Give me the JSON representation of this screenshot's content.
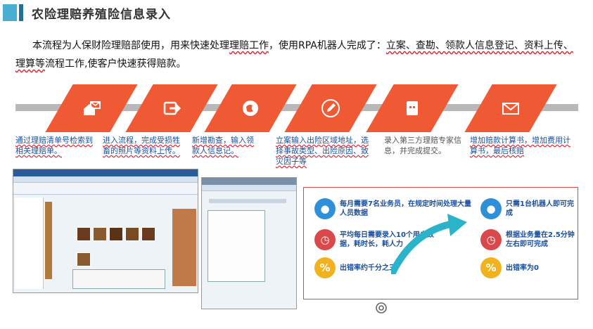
{
  "title": "农险理赔养殖险信息录入",
  "intro_plain_1": "本流程为人保财险理赔部使用，用来快速处理",
  "intro_u_1": "理赔工作",
  "intro_plain_2": "，使用RPA机器人完成了：",
  "intro_u_2": "立案、查勘、领款人信息登记、资料上传、理算等",
  "intro_plain_3": "流程工作,使客户快速获得赔款。",
  "colors": {
    "accent": "#ef5a34",
    "title_block": "#4aaed3",
    "track": "#b8b8b8",
    "link_text": "#1b4f9c",
    "panel_border": "#e04848"
  },
  "steps": [
    {
      "icon": "home-mail-icon",
      "caption": "通过理赔清单号检索到相关理赔单。"
    },
    {
      "icon": "enter-arrow-icon",
      "caption": "进入流程，完成受损牲畜的照片等资料上传。"
    },
    {
      "icon": "new-survey-icon",
      "caption": "新增勘查，输入领款人信息记。"
    },
    {
      "icon": "edit-icon",
      "caption": "立案输入出险区域地址，选择事故类型、出险原因、致灾因子等"
    },
    {
      "icon": "expert-info-icon",
      "caption": "录入第三方理赔专家信息，并完成提交。"
    },
    {
      "icon": "mail-icon",
      "caption": "增加赔款计算书，增加费用计算书，最后核赔"
    }
  ],
  "compare": {
    "before": [
      {
        "icon": "person-icon",
        "color": "#2f8fd8",
        "text": "每月需要7名业务员，在规定时间处理大量人员数据"
      },
      {
        "icon": "clock-icon",
        "color": "#d9484a",
        "text": "平均每日需要录入10个用户数据，耗时长，耗人力"
      },
      {
        "icon": "percent-icon",
        "color": "#f0b21e",
        "text": "出错率约千分之三"
      }
    ],
    "after": [
      {
        "icon": "person-icon",
        "color": "#2f8fd8",
        "text": "只需1台机器人即可完成"
      },
      {
        "icon": "clock-icon",
        "color": "#d9484a",
        "text": "根据业务量在2.5分钟左右即可完成"
      },
      {
        "icon": "percent-icon",
        "color": "#f0b21e",
        "text": "出错率为0"
      }
    ]
  }
}
